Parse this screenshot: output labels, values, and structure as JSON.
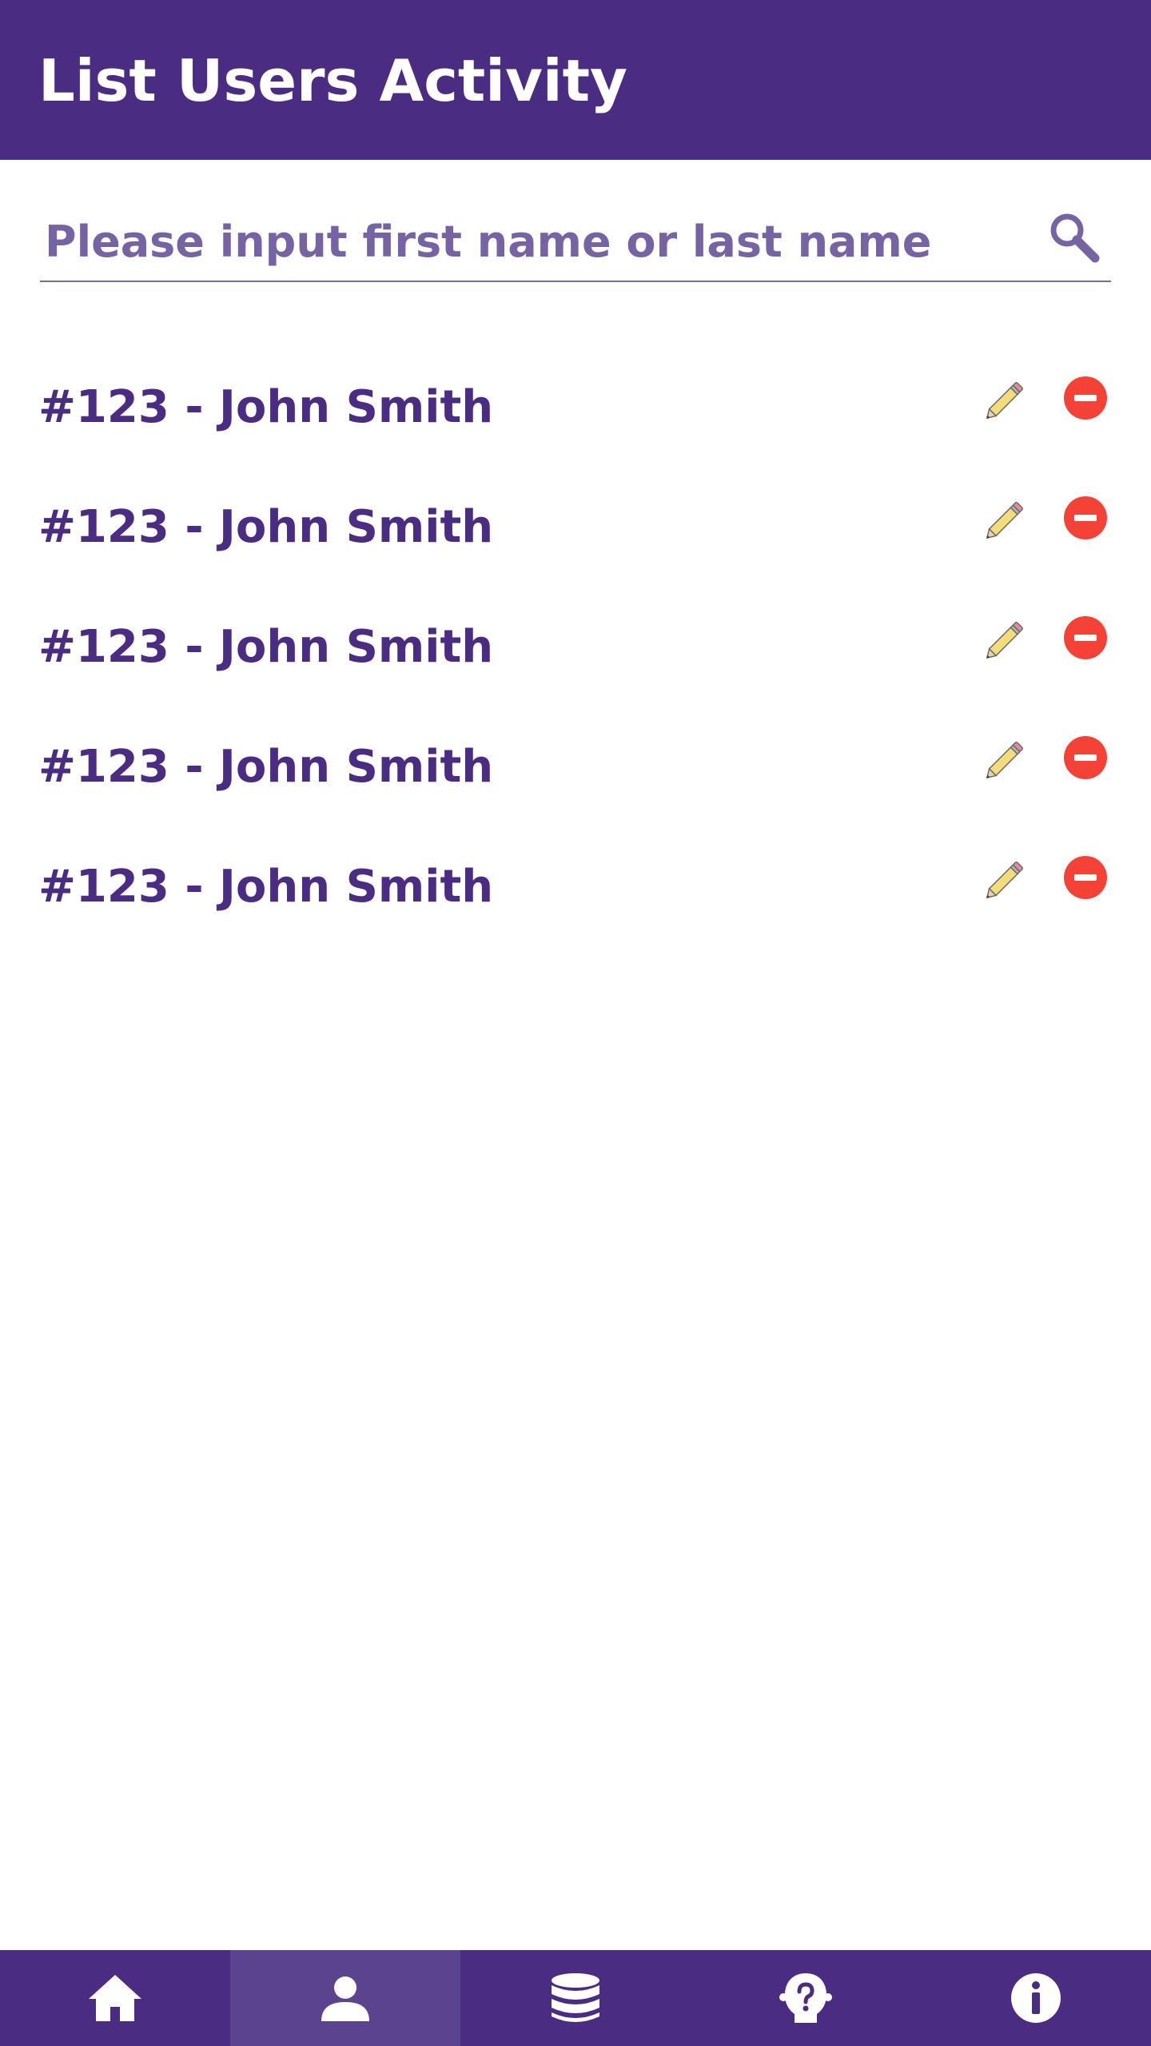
{
  "header": {
    "title": "List Users Activity"
  },
  "search": {
    "placeholder": "Please input first name or last name",
    "value": ""
  },
  "users": [
    {
      "label": "#123 - John Smith"
    },
    {
      "label": "#123 - John Smith"
    },
    {
      "label": "#123 - John Smith"
    },
    {
      "label": "#123 - John Smith"
    },
    {
      "label": "#123 - John Smith"
    }
  ],
  "bottom_nav": {
    "items": [
      {
        "icon": "home-icon",
        "active": false
      },
      {
        "icon": "user-icon",
        "active": true
      },
      {
        "icon": "database-icon",
        "active": false
      },
      {
        "icon": "help-icon",
        "active": false
      },
      {
        "icon": "info-icon",
        "active": false
      }
    ]
  },
  "colors": {
    "primary": "#4a2c82",
    "nav_active": "#5c4390",
    "placeholder": "#7563a3",
    "remove": "#f44336",
    "pencil": "#f3dc7a"
  }
}
